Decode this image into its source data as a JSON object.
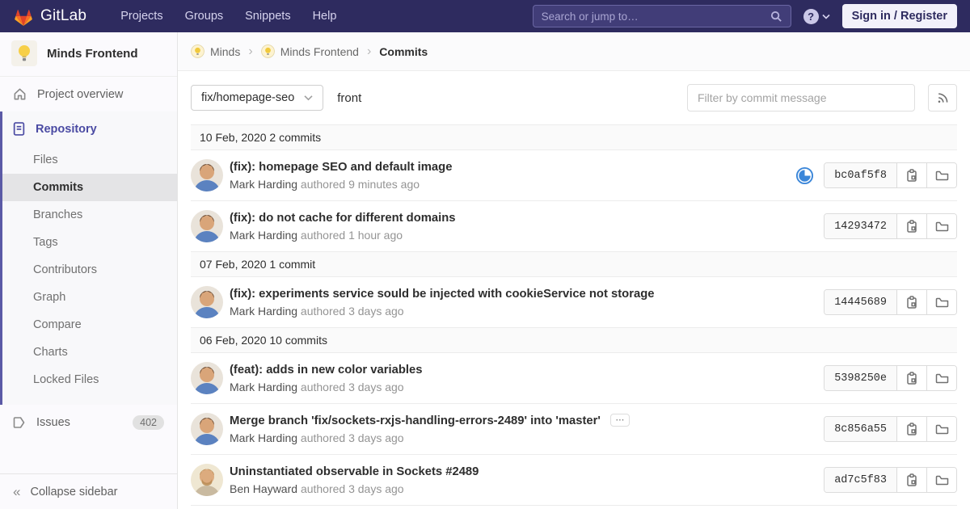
{
  "nav": {
    "logo_text": "GitLab",
    "menu": [
      "Projects",
      "Groups",
      "Snippets",
      "Help"
    ],
    "search_placeholder": "Search or jump to…",
    "help_glyph": "?",
    "sign_in_label": "Sign in / Register"
  },
  "sidebar": {
    "project_name": "Minds Frontend",
    "project_overview_label": "Project overview",
    "repo": {
      "label": "Repository",
      "subitems": [
        "Files",
        "Commits",
        "Branches",
        "Tags",
        "Contributors",
        "Graph",
        "Compare",
        "Charts",
        "Locked Files"
      ],
      "active_subitem": "Commits"
    },
    "issues_label": "Issues",
    "issues_count": "402",
    "collapse_label": "Collapse sidebar",
    "collapse_glyph": "«"
  },
  "breadcrumb": [
    {
      "label": "Minds"
    },
    {
      "label": "Minds Frontend"
    },
    {
      "label": "Commits"
    }
  ],
  "breadcrumb_separator": "›",
  "toolbar": {
    "branch_selector_value": "fix/homepage-seo",
    "ref_path": "front",
    "filter_placeholder": "Filter by commit message"
  },
  "commits": [
    {
      "kind": "date",
      "label": "10 Feb, 2020 2 commits"
    },
    {
      "kind": "commit",
      "title": "(fix): homepage SEO and default image",
      "author": "Mark Harding",
      "authored": "authored 9 minutes ago",
      "hash": "bc0af5f8",
      "pipeline_status": "running"
    },
    {
      "kind": "commit",
      "title": "(fix): do not cache for different domains",
      "author": "Mark Harding",
      "authored": "authored 1 hour ago",
      "hash": "14293472"
    },
    {
      "kind": "date",
      "label": "07 Feb, 2020 1 commit"
    },
    {
      "kind": "commit",
      "title": "(fix): experiments service sould be injected with cookieService not storage",
      "author": "Mark Harding",
      "authored": "authored 3 days ago",
      "hash": "14445689"
    },
    {
      "kind": "date",
      "label": "06 Feb, 2020 10 commits"
    },
    {
      "kind": "commit",
      "title": "(feat): adds in new color variables",
      "author": "Mark Harding",
      "authored": "authored 3 days ago",
      "hash": "5398250e"
    },
    {
      "kind": "commit",
      "title": "Merge branch 'fix/sockets-rxjs-handling-errors-2489' into 'master'",
      "toggle": "⋯",
      "author": "Mark Harding",
      "authored": "authored 3 days ago",
      "hash": "8c856a55"
    },
    {
      "kind": "commit",
      "title": "Uninstantiated observable in Sockets #2489",
      "author": "Ben Hayward",
      "authored": "authored 3 days ago",
      "hash": "ad7c5f83"
    }
  ],
  "colors": {
    "navbar-bg": "#2e2b5f",
    "navbar-text": "#d6d3ee",
    "accent-purple": "#5b5aa6",
    "repo-active-text": "#4b4ba3",
    "running-blue": "#3c87d9",
    "tanuki-red": "#e24329",
    "tanuki-orange": "#fc6d26",
    "tanuki-yellow": "#fca326"
  }
}
